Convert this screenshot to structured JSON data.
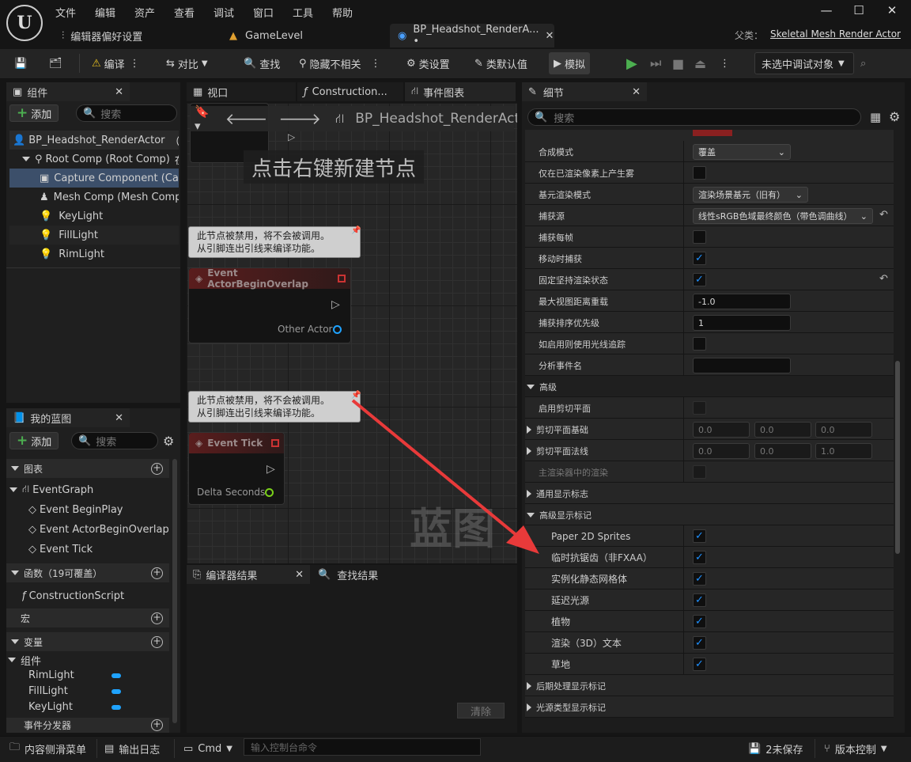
{
  "menu": [
    "文件",
    "编辑",
    "资产",
    "查看",
    "调试",
    "窗口",
    "工具",
    "帮助"
  ],
  "tabs": {
    "prefs": "编辑器偏好设置",
    "level": "GameLevel",
    "bp": "BP_Headshot_RenderA... •"
  },
  "parent_class": {
    "label": "父类：",
    "value": "Skeletal Mesh Render Actor"
  },
  "toolbar": {
    "compile": "编译",
    "diff": "对比",
    "find": "查找",
    "hide_unrelated": "隐藏不相关",
    "class_settings": "类设置",
    "class_defaults": "类默认值",
    "simulate": "模拟",
    "debug_target": "未选中调试对象"
  },
  "components": {
    "title": "组件",
    "add": "添加",
    "search_placeholder": "搜索",
    "items": [
      {
        "label": "BP_Headshot_RenderActor",
        "suffix": "（自"
      },
      {
        "label": "Root Comp (Root Comp)",
        "suffix": "在C"
      },
      {
        "label": "Capture Component (Captu"
      },
      {
        "label": "Mesh Comp (Mesh Comp)"
      },
      {
        "label": "KeyLight"
      },
      {
        "label": "FillLight"
      },
      {
        "label": "RimLight"
      }
    ]
  },
  "mybp": {
    "title": "我的蓝图",
    "add": "添加",
    "search_placeholder": "搜索",
    "graphs": "图表",
    "event_graph": "EventGraph",
    "events": [
      "Event BeginPlay",
      "Event ActorBeginOverlap",
      "Event Tick"
    ],
    "functions": "函数（19可覆盖）",
    "construction": "ConstructionScript",
    "macros": "宏",
    "variables": "变量",
    "components_cat": "组件",
    "vars": [
      "RimLight",
      "FillLight",
      "KeyLight"
    ],
    "dispatchers": "事件分发器"
  },
  "graph_tabs": {
    "viewport": "视口",
    "construction": "Construction...",
    "event_graph": "事件图表"
  },
  "graph": {
    "breadcrumb": "BP_Headshot_RenderActor",
    "hint": "点击右键新建节点",
    "watermark": "蓝图",
    "comment": "此节点被禁用，将不会被调用。\n从引脚连出引线来编译功能。",
    "node1": {
      "title": "Event ActorBeginOverlap",
      "pin": "Other Actor"
    },
    "node2": {
      "title": "Event Tick",
      "pin": "Delta Seconds"
    }
  },
  "compiler": {
    "tab": "编译器结果",
    "find_tab": "查找结果",
    "clear": "清除"
  },
  "details": {
    "title": "细节",
    "search_placeholder": "搜索",
    "rows": {
      "composite": {
        "label": "合成模式",
        "value": "覆盖"
      },
      "fog": {
        "label": "仅在已渲染像素上产生雾"
      },
      "primitive": {
        "label": "基元渲染模式",
        "value": "渲染场景基元（旧有）"
      },
      "capture_source": {
        "label": "捕获源",
        "value": "线性sRGB色域最终颜色（带色调曲线）"
      },
      "every_frame": {
        "label": "捕获每帧"
      },
      "on_movement": {
        "label": "移动时捕获"
      },
      "persist": {
        "label": "固定坚持渲染状态"
      },
      "max_view": {
        "label": "最大视图距离重载",
        "value": "-1.0"
      },
      "priority": {
        "label": "捕获排序优先级",
        "value": "1"
      },
      "raytrace": {
        "label": "如启用则使用光线追踪"
      },
      "profiling": {
        "label": "分析事件名",
        "value": ""
      },
      "advanced": {
        "label": "高级"
      },
      "clip_plane": {
        "label": "启用剪切平面"
      },
      "clip_base": {
        "label": "剪切平面基础",
        "values": [
          "0.0",
          "0.0",
          "0.0"
        ]
      },
      "clip_normal": {
        "label": "剪切平面法线",
        "values": [
          "0.0",
          "0.0",
          "1.0"
        ]
      },
      "main_view": {
        "label": "主渲染器中的渲染"
      },
      "general_flags": {
        "label": "通用显示标志"
      },
      "adv_flags": {
        "label": "高级显示标记"
      },
      "paper2d": {
        "label": "Paper 2D Sprites"
      },
      "taa": {
        "label": "临时抗锯齿（非FXAA）"
      },
      "instanced": {
        "label": "实例化静态网格体"
      },
      "deferred": {
        "label": "延迟光源"
      },
      "foliage": {
        "label": "植物"
      },
      "text3d": {
        "label": "渲染（3D）文本"
      },
      "grass": {
        "label": "草地"
      },
      "postprocess": {
        "label": "后期处理显示标记"
      },
      "light_types": {
        "label": "光源类型显示标记"
      }
    }
  },
  "status": {
    "content_drawer": "内容侧滑菜单",
    "output_log": "输出日志",
    "cmd": "Cmd",
    "console_placeholder": "输入控制台命令",
    "unsaved": "2未保存",
    "source_control": "版本控制"
  },
  "colors": {
    "accent": "#1fa3ff",
    "check": "#1e90ff",
    "arrow": "#e83a3a",
    "play": "#4caf50"
  }
}
